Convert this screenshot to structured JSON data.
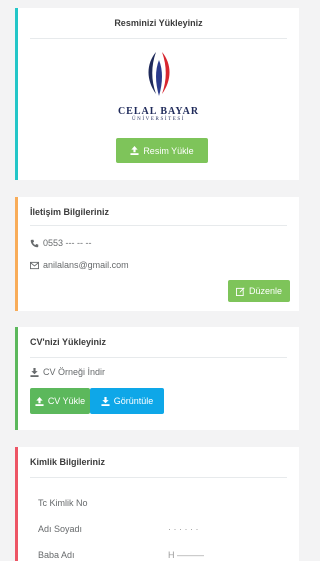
{
  "photo_card": {
    "title": "Resminizi Yükleyiniz",
    "logo_text": "CELAL BAYAR",
    "logo_subtext": "ÜNİVERSİTESİ",
    "upload_button": "Resim Yükle"
  },
  "contact_card": {
    "title": "İletişim Bilgileriniz",
    "phone": "0553 --- -- --",
    "email": "anilalans@gmail.com",
    "edit_button": "Düzenle"
  },
  "cv_card": {
    "title": "CV'nizi Yükleyiniz",
    "sample_link": "CV Örneği İndir",
    "upload_button": "CV Yükle",
    "view_button": "Görüntüle"
  },
  "identity_card": {
    "title": "Kimlik Bilgileriniz",
    "fields": [
      {
        "label": "Tc Kimlik No",
        "value": ""
      },
      {
        "label": "Adı Soyadı",
        "value": "· · · · · ·"
      },
      {
        "label": "Baba Adı",
        "value": "H ———"
      }
    ]
  },
  "colors": {
    "photo_accent": "#23c6c8",
    "contact_accent": "#f8ac59",
    "cv_accent": "#5cb85c",
    "identity_accent": "#ed5565",
    "button_green": "#7ec45a",
    "button_blue": "#0ea7e8"
  }
}
